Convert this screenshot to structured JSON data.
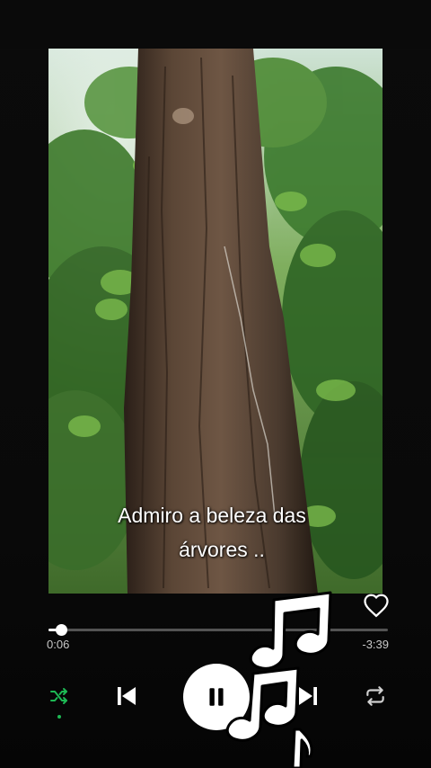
{
  "video": {
    "caption_line1": "Admiro a beleza das",
    "caption_line2": "árvores .."
  },
  "player": {
    "liked": false,
    "elapsed": "0:06",
    "remaining": "-3:39",
    "progress_fraction": 0.036,
    "shuffle_active": true,
    "state": "playing"
  },
  "icons": {
    "like": "heart-outline-icon",
    "shuffle": "shuffle-icon",
    "previous": "skip-previous-icon",
    "play_pause": "pause-icon",
    "next": "skip-next-icon",
    "repeat": "repeat-icon",
    "overlay": "music-notes-icon"
  },
  "colors": {
    "accent": "#1db954",
    "background": "#0a0a0a",
    "track": "#535353",
    "foreground": "#ffffff"
  }
}
